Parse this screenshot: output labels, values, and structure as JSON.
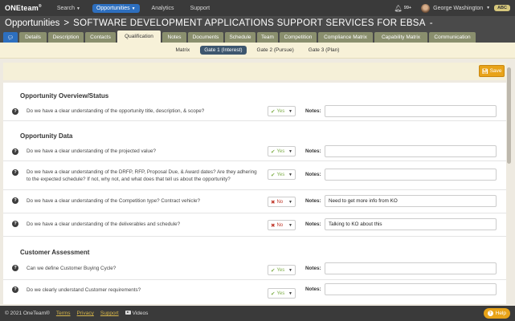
{
  "nav": {
    "logo": "ONEteam",
    "logo_mark": "®",
    "items": [
      {
        "label": "Search"
      },
      {
        "label": "Opportunities"
      },
      {
        "label": "Analytics"
      },
      {
        "label": "Support"
      }
    ],
    "notif_count": "99+",
    "user_name": "George Washington",
    "org_badge": "ABC"
  },
  "title": {
    "main": "Opportunities",
    "separator": ">",
    "sub": "SOFTWARE DEVELOPMENT APPLICATIONS SUPPORT SERVICES FOR EBSA",
    "dash": "-"
  },
  "tabs": [
    "Details",
    "Description",
    "Contacts",
    "Qualification",
    "Notes",
    "Documents",
    "Schedule",
    "Team",
    "Competition",
    "Compliance Matrix",
    "Capability Matrix",
    "Communication"
  ],
  "subtabs": [
    "Matrix",
    "Gate 1 (Interest)",
    "Gate 2 (Pursue)",
    "Gate 3 (Plan)"
  ],
  "save_label": "Save",
  "notes_label": "Notes:",
  "sections": [
    {
      "title": "Opportunity Overview/Status"
    },
    {
      "title": "Opportunity Data"
    },
    {
      "title": "Customer Assessment"
    }
  ],
  "questions": [
    {
      "text": "Do we have a clear understanding of the opportunity title, description, & scope?",
      "answer": "Yes",
      "note": ""
    },
    {
      "text": "Do we have a clear understanding of the projected value?",
      "answer": "Yes",
      "note": ""
    },
    {
      "text": "Do we have a clear understanding of the DRFP, RFP, Proposal Due, & Award dates? Are they adhering to the expected schedule? If not, why not, and what does that tell us about the opportunity?",
      "answer": "Yes",
      "note": ""
    },
    {
      "text": "Do we have a clear understanding of the Competition type? Contract vehicle?",
      "answer": "No",
      "note": "Need to get more info from KO"
    },
    {
      "text": "Do we have a clear understanding of the deliverables and schedule?",
      "answer": "No",
      "note": "Talking to KO about this"
    },
    {
      "text": "Can we define Customer Buying Cycle?",
      "answer": "Yes",
      "note": ""
    },
    {
      "text": "Do we clearly understand Customer requirements?",
      "answer": "Yes",
      "note": ""
    }
  ],
  "footer": {
    "copyright": "© 2021 OneTeam®",
    "links": [
      "Terms",
      "Privacy",
      "Support"
    ],
    "videos": "Videos",
    "help": "Help"
  },
  "colors": {
    "nav_bg": "#3a3a3a",
    "active_blue": "#2d6fbf",
    "tab_olive": "#8a8f6e",
    "save_orange": "#e8a318",
    "yes_green": "#7fae4a",
    "no_red": "#c0392b"
  }
}
